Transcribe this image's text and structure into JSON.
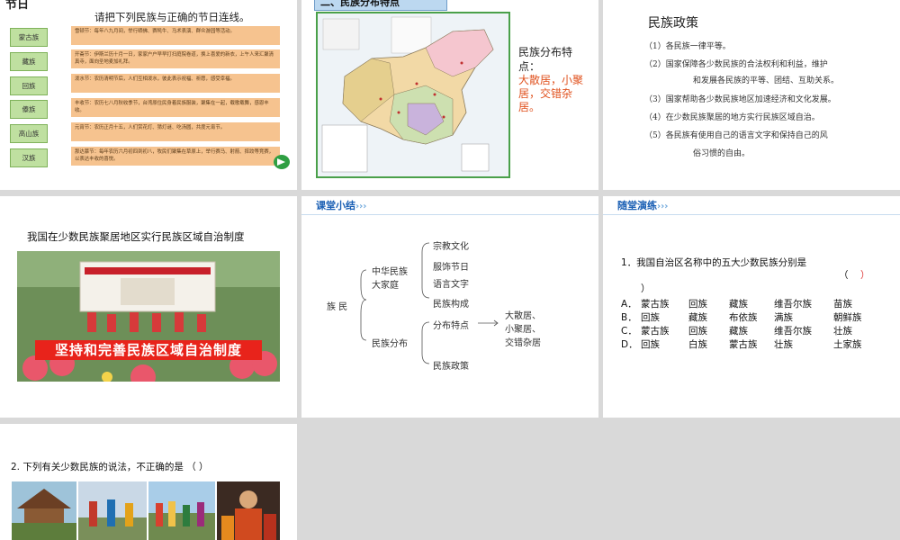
{
  "slide1": {
    "corner_text": "节日",
    "title": "请把下列民族与正确的节日连线。",
    "ethnic_groups": [
      "蒙古族",
      "藏族",
      "回族",
      "傣族",
      "高山族",
      "汉族"
    ],
    "festivals": [
      "雪顿节：每年八九月间，举行晒佛、赛牦牛、马术表演、群众游园等活动。",
      "开斋节：伊斯兰历十月一日，家家户户早早打扫庭院卷道，换上喜爱的新衣，上午人来汇聚清真寺，面向圣地麦加礼拜。",
      "泼水节：农历清明节后，人们互相泼水，彼此表示祝福、祈愿，感受幸福。",
      "丰收节：农历七八月秋收季节，台湾原住民身着民族服装，聚集在一起，载歌载舞，感恩丰收。",
      "元宵节：农历正月十五，人们赏花灯、猜灯谜、吃汤圆，共度元宵节。",
      "那达慕节：每年农历六月初四到初八，牧民们聚集在草原上，举行赛马、射箭、摔跤等竞赛，以表达丰收的喜悦。"
    ]
  },
  "slide2": {
    "section_title": "二、民族分布特点",
    "label": "民族分布特点：",
    "answer": "大散居，小聚居，交错杂居。"
  },
  "slide3": {
    "title": "民族政策",
    "items": [
      "（1）各民族一律平等。",
      "（2）国家保障各少数民族的合法权利和利益，维护",
      "（3）国家帮助各少数民族地区加速经济和文化发展。",
      "（4）在少数民族聚居的地方实行民族区域自治。",
      "（5）各民族有使用自己的语言文字和保持自己的风"
    ],
    "continuations": [
      "和发展各民族的平等、团结、互助关系。",
      "俗习惯的自由。"
    ]
  },
  "slide4": {
    "title": "我国在少数民族聚居地区实行民族区域自治制度",
    "banner": "坚持和完善民族区域自治制度"
  },
  "slide5": {
    "header": "课堂小结",
    "root": "族 民",
    "branch1": [
      "中华民族",
      "大家庭"
    ],
    "branch1_leaves": [
      "宗教文化",
      "服饰节日",
      "语言文字",
      "民族构成"
    ],
    "branch2": "民族分布",
    "branch2_leaves": [
      "分布特点",
      "民族政策"
    ],
    "result": [
      "大散居、",
      "小聚居、",
      "交错杂居"
    ]
  },
  "slide6": {
    "header": "随堂演练",
    "question": "1．我国自治区名称中的五大少数民族分别是",
    "bracket_open": "（",
    "bracket_close": "）",
    "options": [
      {
        "letter": "A．",
        "items": [
          "蒙古族",
          "回族",
          "藏族",
          "维吾尔族",
          "苗族"
        ]
      },
      {
        "letter": "B．",
        "items": [
          "回族",
          "藏族",
          "布依族",
          "满族",
          "朝鲜族"
        ]
      },
      {
        "letter": "C．",
        "items": [
          "蒙古族",
          "回族",
          "藏族",
          "维吾尔族",
          "壮族"
        ]
      },
      {
        "letter": "D．",
        "items": [
          "回族",
          "白族",
          "蒙古族",
          "壮族",
          "土家族"
        ]
      }
    ]
  },
  "slide7": {
    "question": "2. 下列有关少数民族的说法，不正确的是 （ ）"
  },
  "colors": {
    "background": "#d9d9d9",
    "festival_box": "#f6c38f",
    "ethnic_button": "#bfe0a0",
    "accent_red": "#e0521f",
    "header_blue": "#1a5fb4"
  }
}
